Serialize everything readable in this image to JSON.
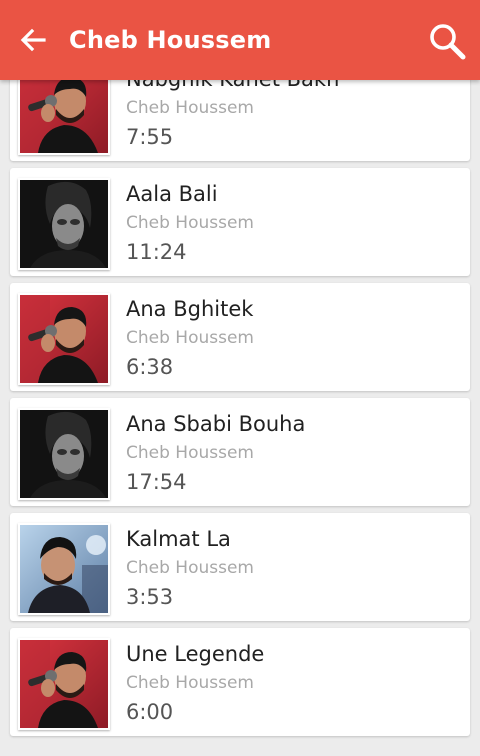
{
  "app_bar": {
    "title": "Cheb Houssem",
    "back_icon": "arrow-left-icon",
    "search_icon": "search-icon",
    "background_color": "#ea5444"
  },
  "songs": [
    {
      "title": "Nabghik Kahet Bakh",
      "artist": "Cheb Houssem",
      "duration": "7:55",
      "thumbnail": "singer-mic-red-thumbnail"
    },
    {
      "title": "Aala Bali",
      "artist": "Cheb Houssem",
      "duration": "11:24",
      "thumbnail": "singer-dark-portrait-thumbnail"
    },
    {
      "title": "Ana Bghitek",
      "artist": "Cheb Houssem",
      "duration": "6:38",
      "thumbnail": "singer-mic-red-thumbnail"
    },
    {
      "title": "Ana Sbabi Bouha",
      "artist": "Cheb Houssem",
      "duration": "17:54",
      "thumbnail": "singer-dark-portrait-thumbnail"
    },
    {
      "title": "Kalmat La",
      "artist": "Cheb Houssem",
      "duration": "3:53",
      "thumbnail": "singer-stage-blue-thumbnail"
    },
    {
      "title": "Une Legende",
      "artist": "Cheb Houssem",
      "duration": "6:00",
      "thumbnail": "singer-mic-red-thumbnail"
    }
  ]
}
